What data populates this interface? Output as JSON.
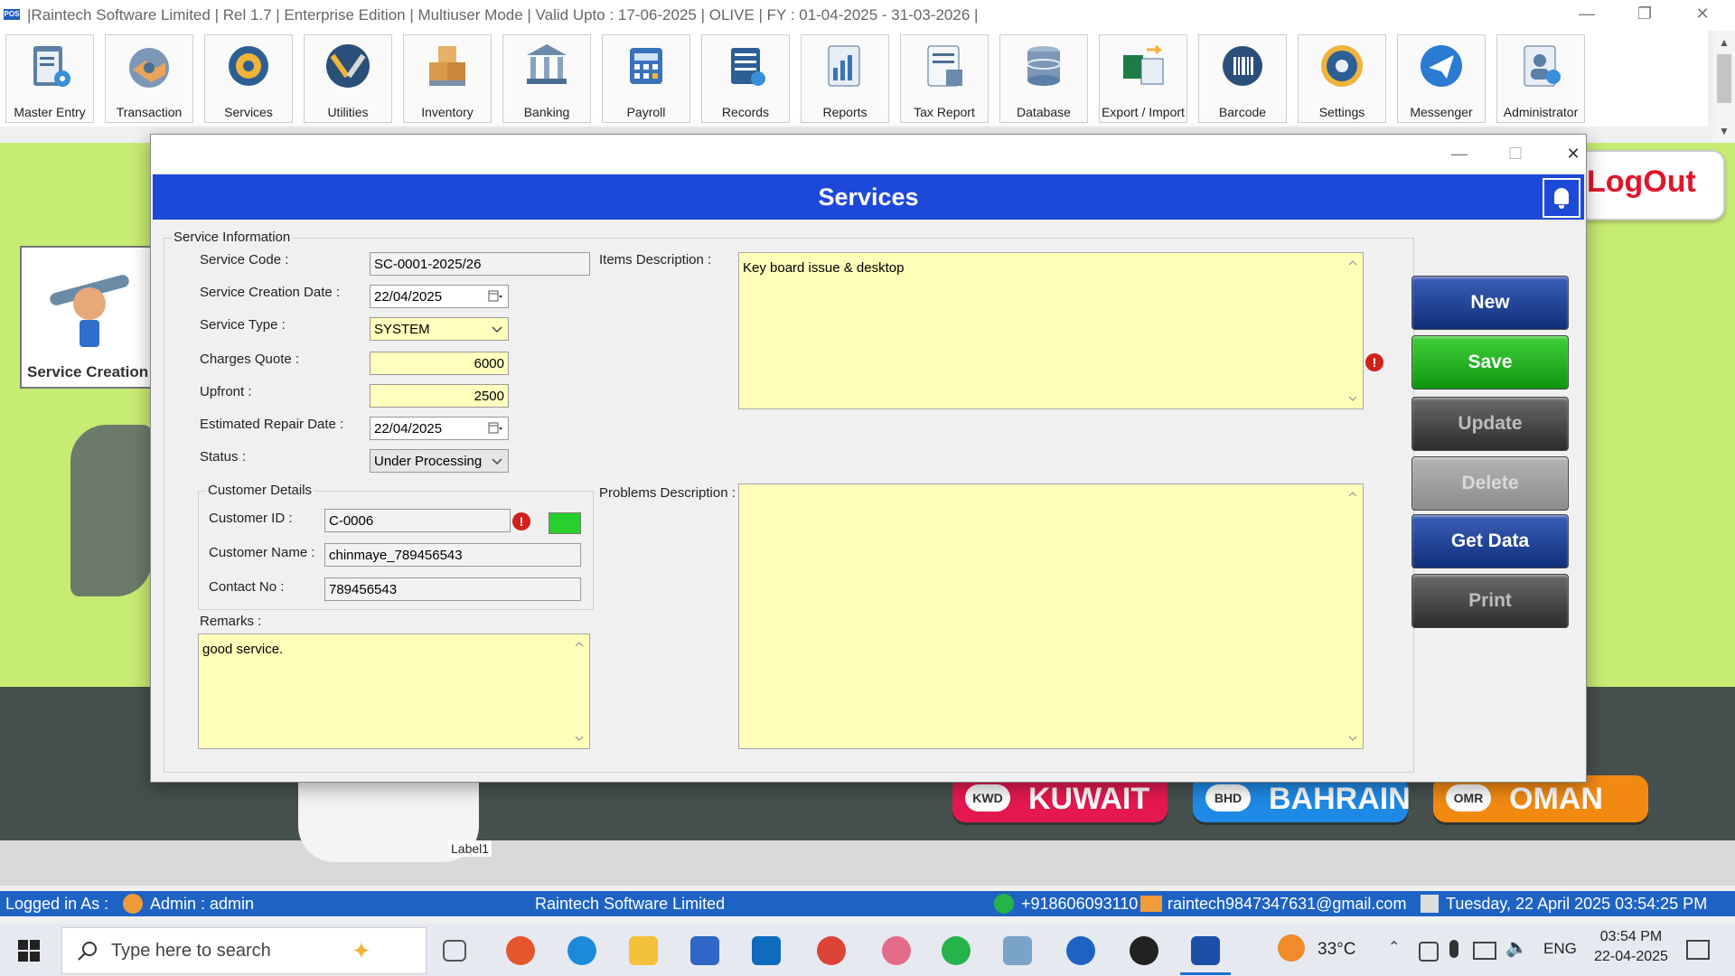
{
  "window": {
    "title": "|Raintech Software Limited  |  Rel 1.7  |  Enterprise Edition  |  Multiuser Mode  |  Valid Upto : 17-06-2025  |  OLIVE  |  FY : 01-04-2025  -  31-03-2026  |",
    "logo": "POS"
  },
  "toolbar": {
    "items": [
      {
        "label": "Master Entry",
        "icon": "clipboard-gear-icon"
      },
      {
        "label": "Transaction",
        "icon": "handshake-icon"
      },
      {
        "label": "Services",
        "icon": "service-gear-icon"
      },
      {
        "label": "Utilities",
        "icon": "tools-icon"
      },
      {
        "label": "Inventory",
        "icon": "boxes-icon"
      },
      {
        "label": "Banking",
        "icon": "bank-icon"
      },
      {
        "label": "Payroll",
        "icon": "payroll-icon"
      },
      {
        "label": "Records",
        "icon": "records-icon"
      },
      {
        "label": "Reports",
        "icon": "reports-icon"
      },
      {
        "label": "Tax Report",
        "icon": "tax-report-icon"
      },
      {
        "label": "Database",
        "icon": "database-icon"
      },
      {
        "label": "Export / Import",
        "icon": "export-import-icon"
      },
      {
        "label": "Barcode",
        "icon": "barcode-scanner-icon"
      },
      {
        "label": "Settings",
        "icon": "settings-gear-icon"
      },
      {
        "label": "Messenger",
        "icon": "messenger-icon"
      },
      {
        "label": "Administrator",
        "icon": "administrator-icon"
      }
    ]
  },
  "background": {
    "logout": "LogOut",
    "service_creation": "Service Creation",
    "label1": "Label1",
    "flags": [
      {
        "code": "KWD",
        "name": "KUWAIT",
        "color": "#e5194f"
      },
      {
        "code": "BHD",
        "name": "BAHRAIN",
        "color": "#1f8ae6"
      },
      {
        "code": "OMR",
        "name": "OMAN",
        "color": "#f28a12"
      }
    ]
  },
  "dialog": {
    "header": "Services",
    "service_info": {
      "title": "Service Information",
      "service_code_label": "Service Code :",
      "service_code": "SC-0001-2025/26",
      "creation_date_label": "Service Creation Date :",
      "creation_date": "22/04/2025",
      "service_type_label": "Service Type :",
      "service_type": "SYSTEM",
      "charges_quote_label": "Charges Quote :",
      "charges_quote": "6000",
      "upfront_label": "Upfront :",
      "upfront": "2500",
      "repair_date_label": "Estimated Repair Date :",
      "repair_date": "22/04/2025",
      "status_label": "Status :",
      "status": "Under Processing"
    },
    "customer": {
      "title": "Customer Details",
      "id_label": "Customer ID :",
      "id": "C-0006",
      "name_label": "Customer Name :",
      "name": "chinmaye_789456543",
      "contact_label": "Contact No :",
      "contact": "789456543"
    },
    "remarks_label": "Remarks :",
    "remarks": "good service.",
    "items_desc_label": "Items Description :",
    "items_desc": "Key board issue & desktop",
    "problems_desc_label": "Problems Description :",
    "problems_desc": "",
    "buttons": {
      "new": "New",
      "save": "Save",
      "update": "Update",
      "delete": "Delete",
      "get_data": "Get Data",
      "print": "Print"
    }
  },
  "status_bar": {
    "logged_in_as": "Logged in As :",
    "user": "Admin  :  admin",
    "company": "Raintech Software Limited",
    "phone": "+918606093110",
    "email": "raintech9847347631@gmail.com",
    "datetime": "Tuesday, 22 April 2025 03:54:25 PM"
  },
  "taskbar": {
    "search_placeholder": "Type here to search",
    "temperature": "33°C",
    "language": "ENG",
    "time": "03:54 PM",
    "date": "22-04-2025"
  }
}
